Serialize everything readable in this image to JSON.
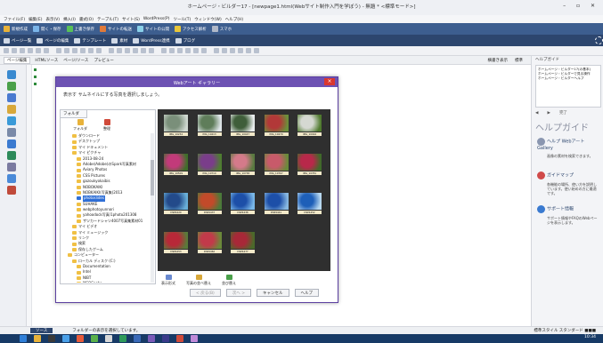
{
  "window": {
    "title": "ホームページ・ビルダー17 - [newpage1.html(Webサイト制作入門を学ぼう) - 無題 * <標準モード>]",
    "controls": "– ▫ ✕"
  },
  "menubar": [
    "ファイル(F)",
    "編集(E)",
    "表示(V)",
    "挿入(I)",
    "書式(O)",
    "テーブル(T)",
    "サイト(S)",
    "WordPress(P)",
    "ツール(T)",
    "ウィンドウ(W)",
    "ヘルプ(H)"
  ],
  "toolbar1": [
    {
      "label": "新規作成",
      "color": "#e8b23a"
    },
    {
      "label": "開く・保存",
      "color": "#7ab4e8"
    },
    {
      "label": "上書き保存",
      "color": "#58c058"
    },
    {
      "label": "サイトの転送",
      "color": "#e07a3a"
    },
    {
      "label": "サイトの公開",
      "color": "#8ad0e8"
    },
    {
      "label": "アクセス解析",
      "color": "#e8c63a"
    },
    {
      "label": "スマホ",
      "color": "#b0b8c8"
    }
  ],
  "toolbar2": [
    "ページ一覧",
    "ページの編集",
    "テンプレート",
    "素材",
    "WordPress連携",
    "ブログ"
  ],
  "tabs": {
    "active": "ページ編集",
    "others": [
      "HTMLソース",
      "ページ/ソース",
      "プレビュー"
    ]
  },
  "canvas_status": [
    "横書き表示",
    "標準"
  ],
  "dialog": {
    "title": "Webアート ギャラリー",
    "message": "表示す サムネイルにする写真を選択しましょう。",
    "folder_tab": "フォルダ",
    "tools": [
      "フォルダ",
      "整理"
    ],
    "tree": [
      {
        "label": "ダウンロード",
        "depth": 1
      },
      {
        "label": "デスクトップ",
        "depth": 1
      },
      {
        "label": "マイ ドキュメント",
        "depth": 1
      },
      {
        "label": "マイ ピクチャ",
        "depth": 1
      },
      {
        "label": "2013-08-24",
        "depth": 2
      },
      {
        "label": "Adobe(Adobe)のSpark写真素材",
        "depth": 2
      },
      {
        "label": "Aviary Photos",
        "depth": 2
      },
      {
        "label": "CSS Pictures",
        "depth": 2
      },
      {
        "label": "gazoukyokaibis",
        "depth": 2
      },
      {
        "label": "NOBOKAIKI",
        "depth": 2
      },
      {
        "label": "NOBKAIKI(写真集)2013",
        "depth": 2
      },
      {
        "label": "photoslides",
        "depth": 2,
        "selected": true
      },
      {
        "label": "SUHAKE",
        "depth": 2
      },
      {
        "label": "webphotoyunnori",
        "depth": 2
      },
      {
        "label": "yahoodock写真/1photo201308",
        "depth": 2
      },
      {
        "label": "ザツカードシャツ4007写真集素材01",
        "depth": 2
      },
      {
        "label": "マイ ビデオ",
        "depth": 1
      },
      {
        "label": "マイ ミュージック",
        "depth": 1
      },
      {
        "label": "リンク",
        "depth": 1
      },
      {
        "label": "検索",
        "depth": 1
      },
      {
        "label": "保存したゲーム",
        "depth": 1
      },
      {
        "label": "コンピューター",
        "depth": 0
      },
      {
        "label": "ローカル ディスク (C:)",
        "depth": 1
      },
      {
        "label": "Documentation",
        "depth": 2
      },
      {
        "label": "Intel",
        "depth": 2
      },
      {
        "label": "NIBT",
        "depth": 2
      },
      {
        "label": "MSOCache",
        "depth": 2
      }
    ],
    "thumbnails": [
      {
        "caption": "IMG_10234",
        "c1": "#7a8f7a",
        "c2": "#cfd8d0"
      },
      {
        "caption": "IMG_10413",
        "c1": "#5f7d5a",
        "c2": "#dfe6e9"
      },
      {
        "caption": "IMG_10447",
        "c1": "#3f5e3a",
        "c2": "#e8ecec"
      },
      {
        "caption": "IMG_10479",
        "c1": "#b23838",
        "c2": "#6b8f3a"
      },
      {
        "caption": "IMG_10494",
        "c1": "#d5d8d2",
        "c2": "#4f7a2e"
      },
      {
        "caption": "IMG_10509",
        "c1": "#c23a7a",
        "c2": "#3f6e2a"
      },
      {
        "caption": "IMG_10710",
        "c1": "#7a3d8a",
        "c2": "#4e7e30"
      },
      {
        "caption": "IMG_10738",
        "c1": "#d47a8a",
        "c2": "#5a7a40"
      },
      {
        "caption": "IMG_10767",
        "c1": "#c85a6a",
        "c2": "#6a8a3a"
      },
      {
        "caption": "IMG_10781",
        "c1": "#b8284a",
        "c2": "#3f6a2a"
      },
      {
        "caption": "DSP4429",
        "c1": "#234a8a",
        "c2": "#6ab0d8"
      },
      {
        "caption": "DSP4437",
        "c1": "#c24a2a",
        "c2": "#4a7a3a"
      },
      {
        "caption": "DSP4438",
        "c1": "#1d4fa8",
        "c2": "#7ab8e8"
      },
      {
        "caption": "DSP4441",
        "c1": "#1d4fa8",
        "c2": "#88b8e0"
      },
      {
        "caption": "DSP4452",
        "c1": "#1e5fb8",
        "c2": "#b8d8f0"
      },
      {
        "caption": "DSP4453",
        "c1": "#b82838",
        "c2": "#5a7a3a"
      },
      {
        "caption": "DSP4462",
        "c1": "#c23a4a",
        "c2": "#6a8a3a"
      },
      {
        "caption": "DSP4477",
        "c1": "#a82838",
        "c2": "#4a6a2a"
      }
    ],
    "grid_tools": [
      "表示形式",
      "写真の並べ替え",
      "並び替え"
    ],
    "buttons": [
      {
        "label": "< 戻る(B)",
        "disabled": true
      },
      {
        "label": "次へ >",
        "disabled": true
      },
      {
        "label": "キャンセル",
        "disabled": false
      },
      {
        "label": "ヘルプ",
        "disabled": false
      }
    ]
  },
  "rightpane": {
    "top_label": "ヘルプガイド",
    "list": [
      "ホームページ・ビルダー17(の基本)",
      "ホームページ・ビルダーで見る操作",
      "ホームページ・ビルダーヘルプ"
    ],
    "nav": [
      "◀",
      "▶",
      "完了"
    ],
    "heading": "ヘルプガイド",
    "items": [
      {
        "title": "ヘルプ WebアートGallery",
        "desc": "画像の素材を検索できます。",
        "color": "#8a96b0"
      },
      {
        "title": "ガイドマップ",
        "desc": "各機能の場所、使い方を説明しています。使い始めの方に最適です。",
        "color": "#d04a4a"
      },
      {
        "title": "サポート情報",
        "desc": "サポート情報やFAQのWebページを表示します。",
        "color": "#3a7ad0"
      }
    ]
  },
  "status": {
    "left": "ソース",
    "text": "フォルダーの表示を選択しています。",
    "right": "標準スタイル  スタンダード  ■■■"
  },
  "taskbar": {
    "icons": [
      "#2f7fd8",
      "#e8b23a",
      "#3a3a3a",
      "#4aa0e8",
      "#e85a3a",
      "#5ab04a",
      "#d8d8d8",
      "#2e9a5a",
      "#3a6ab8",
      "#7a5ab8",
      "#3a3a8a",
      "#d04a3a",
      "#c08ad8"
    ],
    "time": "10:34"
  }
}
